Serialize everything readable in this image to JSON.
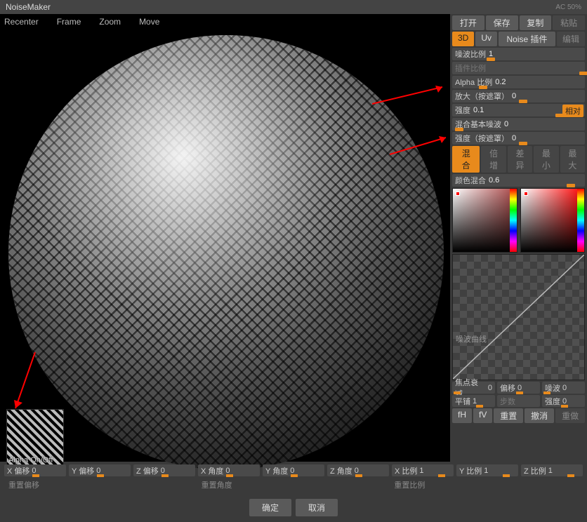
{
  "title": "NoiseMaker",
  "status": "AC 50%",
  "viewport_menu": [
    "Recenter",
    "Frame",
    "Zoom",
    "Move"
  ],
  "alpha_thumb_label": "Alpha On/Off",
  "top_buttons": {
    "open": "打开",
    "save": "保存",
    "copy": "复制",
    "paste": "粘贴"
  },
  "mode_row": {
    "threeD": "3D",
    "uv": "Uv",
    "noise_plugin": "Noise 插件",
    "edit": "编辑"
  },
  "sliders": {
    "noise_scale": {
      "label": "噪波比例",
      "value": "1",
      "pos": 26
    },
    "plugin_scale": {
      "label": "插件比例",
      "value": "",
      "pos": 100,
      "dim": true
    },
    "alpha_scale": {
      "label": "Alpha 比例",
      "value": "0.2",
      "pos": 20
    },
    "zoom_mask": {
      "label": "放大（按遮罩）",
      "value": "0",
      "pos": 50
    },
    "strength": {
      "label": "强度",
      "value": "0.1",
      "pos": 80,
      "rel": "相对"
    },
    "mix_base": {
      "label": "混合基本噪波",
      "value": "0",
      "pos": 2
    },
    "strength_mask": {
      "label": "强度（按遮罩）",
      "value": "0",
      "pos": 50
    },
    "color_mix": {
      "label": "颜色混合",
      "value": "0.6",
      "pos": 88
    }
  },
  "blend_row": {
    "blend": "混合",
    "mult": "倍增",
    "diff": "差异",
    "min": "最小",
    "max": "最大"
  },
  "curve_label": "噪波曲线",
  "bottom_sliders_a": {
    "focal": {
      "label": "焦点衰减",
      "value": "0"
    },
    "offset": {
      "label": "偏移",
      "value": "0"
    },
    "noise": {
      "label": "噪波",
      "value": "0"
    }
  },
  "bottom_sliders_b": {
    "tile": {
      "label": "平铺",
      "value": "1"
    },
    "steps": {
      "label": "步数",
      "value": ""
    },
    "strength": {
      "label": "强度",
      "value": "0"
    }
  },
  "action_row": {
    "fh": "fH",
    "fv": "fV",
    "reset": "重置",
    "undo": "撤消",
    "redo": "重做"
  },
  "bottom_grid": [
    {
      "label": "X 偏移",
      "value": "0",
      "pos": 45
    },
    {
      "label": "Y 偏移",
      "value": "0",
      "pos": 45
    },
    {
      "label": "Z 偏移",
      "value": "0",
      "pos": 45
    },
    {
      "label": "X 角度",
      "value": "0",
      "pos": 45
    },
    {
      "label": "Y 角度",
      "value": "0",
      "pos": 45
    },
    {
      "label": "Z 角度",
      "value": "0",
      "pos": 45
    },
    {
      "label": "X 比例",
      "value": "1",
      "pos": 75
    },
    {
      "label": "Y 比例",
      "value": "1",
      "pos": 75
    },
    {
      "label": "Z 比例",
      "value": "1",
      "pos": 75
    }
  ],
  "resets": {
    "offset": "重置偏移",
    "angle": "重置角度",
    "scale": "重置比例"
  },
  "ok": "确定",
  "cancel": "取消"
}
